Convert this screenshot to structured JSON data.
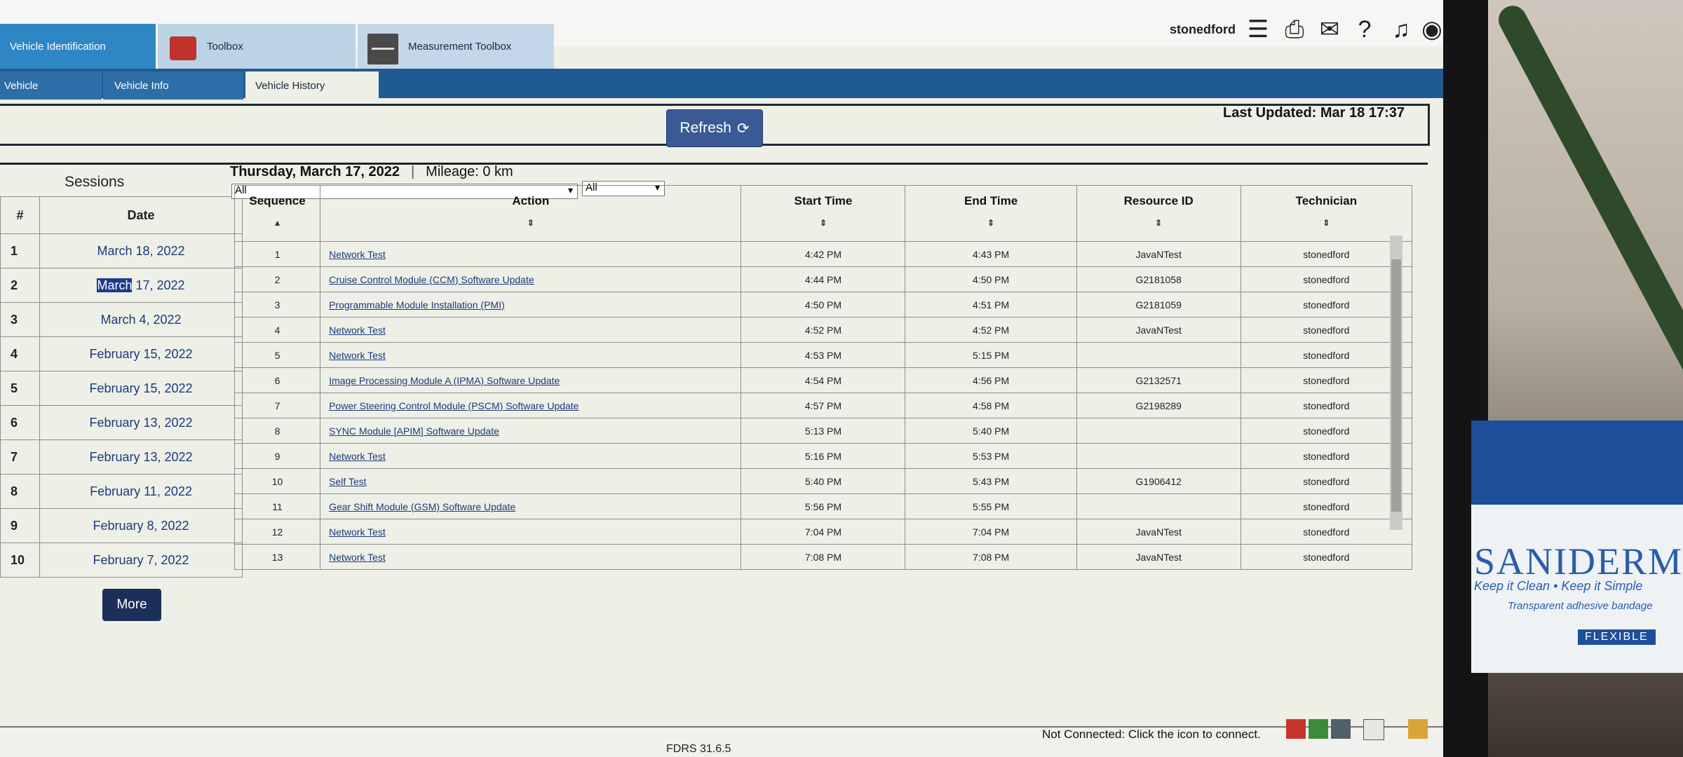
{
  "top_tabs": [
    {
      "label": "Vehicle Identification"
    },
    {
      "label": "Toolbox"
    },
    {
      "label": "Measurement Toolbox"
    }
  ],
  "user": "stonedford",
  "sub_tabs": [
    {
      "label": "Vehicle"
    },
    {
      "label": "Vehicle Info"
    },
    {
      "label": "Vehicle History"
    }
  ],
  "refresh_label": "Refresh",
  "last_updated": "Last Updated: Mar 18 17:37",
  "sessions": {
    "title": "Sessions",
    "headers": [
      "#",
      "Date"
    ],
    "rows": [
      {
        "num": "1",
        "date": "March 18, 2022"
      },
      {
        "num": "2",
        "date": "March 17, 2022"
      },
      {
        "num": "3",
        "date": "March 4, 2022"
      },
      {
        "num": "4",
        "date": "February 15, 2022"
      },
      {
        "num": "5",
        "date": "February 15, 2022"
      },
      {
        "num": "6",
        "date": "February 13, 2022"
      },
      {
        "num": "7",
        "date": "February 13, 2022"
      },
      {
        "num": "8",
        "date": "February 11, 2022"
      },
      {
        "num": "9",
        "date": "February 8, 2022"
      },
      {
        "num": "10",
        "date": "February 7, 2022"
      }
    ],
    "more_label": "More",
    "selected_word": "March",
    "selected_rest": " 17, 2022"
  },
  "day": {
    "title": "Thursday, March 17, 2022",
    "separator": "|",
    "mileage": "Mileage: 0 km"
  },
  "filters": {
    "action": "All",
    "technician": "All"
  },
  "grid": {
    "headers": [
      "Sequence",
      "Action",
      "Start Time",
      "End Time",
      "Resource ID",
      "Technician"
    ],
    "rows": [
      {
        "seq": "1",
        "action": "Network Test",
        "start": "4:42 PM",
        "end": "4:43 PM",
        "res": "JavaNTest",
        "tech": "stonedford"
      },
      {
        "seq": "2",
        "action": "Cruise Control Module (CCM) Software Update",
        "start": "4:44 PM",
        "end": "4:50 PM",
        "res": "G2181058",
        "tech": "stonedford"
      },
      {
        "seq": "3",
        "action": "Programmable Module Installation (PMI)",
        "start": "4:50 PM",
        "end": "4:51 PM",
        "res": "G2181059",
        "tech": "stonedford"
      },
      {
        "seq": "4",
        "action": "Network Test",
        "start": "4:52 PM",
        "end": "4:52 PM",
        "res": "JavaNTest",
        "tech": "stonedford"
      },
      {
        "seq": "5",
        "action": "Network Test",
        "start": "4:53 PM",
        "end": "5:15 PM",
        "res": "",
        "tech": "stonedford"
      },
      {
        "seq": "6",
        "action": "Image Processing Module A (IPMA) Software Update",
        "start": "4:54 PM",
        "end": "4:56 PM",
        "res": "G2132571",
        "tech": "stonedford"
      },
      {
        "seq": "7",
        "action": "Power Steering Control Module (PSCM) Software Update",
        "start": "4:57 PM",
        "end": "4:58 PM",
        "res": "G2198289",
        "tech": "stonedford"
      },
      {
        "seq": "8",
        "action": "SYNC Module [APIM] Software Update",
        "start": "5:13 PM",
        "end": "5:40 PM",
        "res": "",
        "tech": "stonedford"
      },
      {
        "seq": "9",
        "action": "Network Test",
        "start": "5:16 PM",
        "end": "5:53 PM",
        "res": "",
        "tech": "stonedford"
      },
      {
        "seq": "10",
        "action": "Self Test",
        "start": "5:40 PM",
        "end": "5:43 PM",
        "res": "G1906412",
        "tech": "stonedford"
      },
      {
        "seq": "11",
        "action": "Gear Shift Module (GSM) Software Update",
        "start": "5:56 PM",
        "end": "5:55 PM",
        "res": "",
        "tech": "stonedford"
      },
      {
        "seq": "12",
        "action": "Network Test",
        "start": "7:04 PM",
        "end": "7:04 PM",
        "res": "JavaNTest",
        "tech": "stonedford"
      },
      {
        "seq": "13",
        "action": "Network Test",
        "start": "7:08 PM",
        "end": "7:08 PM",
        "res": "JavaNTest",
        "tech": "stonedford"
      }
    ]
  },
  "status": {
    "connection": "Not Connected: Click the icon to connect.",
    "version": "FDRS 31.6.5"
  },
  "background": {
    "brand": "SANIDERM",
    "tagline": "Keep it Clean • Keep it Simple",
    "tagline2": "Transparent adhesive bandage",
    "flex": "FLEXIBLE"
  }
}
